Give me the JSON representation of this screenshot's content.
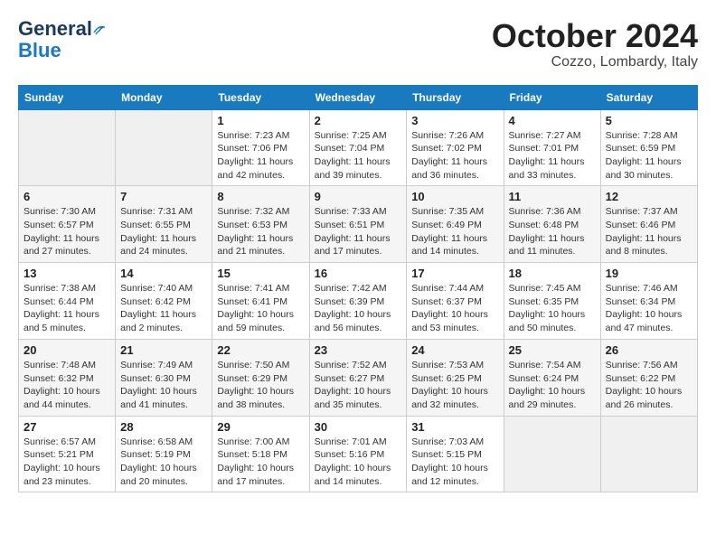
{
  "header": {
    "logo_line1": "General",
    "logo_line2": "Blue",
    "month": "October 2024",
    "location": "Cozzo, Lombardy, Italy"
  },
  "weekdays": [
    "Sunday",
    "Monday",
    "Tuesday",
    "Wednesday",
    "Thursday",
    "Friday",
    "Saturday"
  ],
  "weeks": [
    [
      {
        "day": "",
        "sunrise": "",
        "sunset": "",
        "daylight": ""
      },
      {
        "day": "",
        "sunrise": "",
        "sunset": "",
        "daylight": ""
      },
      {
        "day": "1",
        "sunrise": "Sunrise: 7:23 AM",
        "sunset": "Sunset: 7:06 PM",
        "daylight": "Daylight: 11 hours and 42 minutes."
      },
      {
        "day": "2",
        "sunrise": "Sunrise: 7:25 AM",
        "sunset": "Sunset: 7:04 PM",
        "daylight": "Daylight: 11 hours and 39 minutes."
      },
      {
        "day": "3",
        "sunrise": "Sunrise: 7:26 AM",
        "sunset": "Sunset: 7:02 PM",
        "daylight": "Daylight: 11 hours and 36 minutes."
      },
      {
        "day": "4",
        "sunrise": "Sunrise: 7:27 AM",
        "sunset": "Sunset: 7:01 PM",
        "daylight": "Daylight: 11 hours and 33 minutes."
      },
      {
        "day": "5",
        "sunrise": "Sunrise: 7:28 AM",
        "sunset": "Sunset: 6:59 PM",
        "daylight": "Daylight: 11 hours and 30 minutes."
      }
    ],
    [
      {
        "day": "6",
        "sunrise": "Sunrise: 7:30 AM",
        "sunset": "Sunset: 6:57 PM",
        "daylight": "Daylight: 11 hours and 27 minutes."
      },
      {
        "day": "7",
        "sunrise": "Sunrise: 7:31 AM",
        "sunset": "Sunset: 6:55 PM",
        "daylight": "Daylight: 11 hours and 24 minutes."
      },
      {
        "day": "8",
        "sunrise": "Sunrise: 7:32 AM",
        "sunset": "Sunset: 6:53 PM",
        "daylight": "Daylight: 11 hours and 21 minutes."
      },
      {
        "day": "9",
        "sunrise": "Sunrise: 7:33 AM",
        "sunset": "Sunset: 6:51 PM",
        "daylight": "Daylight: 11 hours and 17 minutes."
      },
      {
        "day": "10",
        "sunrise": "Sunrise: 7:35 AM",
        "sunset": "Sunset: 6:49 PM",
        "daylight": "Daylight: 11 hours and 14 minutes."
      },
      {
        "day": "11",
        "sunrise": "Sunrise: 7:36 AM",
        "sunset": "Sunset: 6:48 PM",
        "daylight": "Daylight: 11 hours and 11 minutes."
      },
      {
        "day": "12",
        "sunrise": "Sunrise: 7:37 AM",
        "sunset": "Sunset: 6:46 PM",
        "daylight": "Daylight: 11 hours and 8 minutes."
      }
    ],
    [
      {
        "day": "13",
        "sunrise": "Sunrise: 7:38 AM",
        "sunset": "Sunset: 6:44 PM",
        "daylight": "Daylight: 11 hours and 5 minutes."
      },
      {
        "day": "14",
        "sunrise": "Sunrise: 7:40 AM",
        "sunset": "Sunset: 6:42 PM",
        "daylight": "Daylight: 11 hours and 2 minutes."
      },
      {
        "day": "15",
        "sunrise": "Sunrise: 7:41 AM",
        "sunset": "Sunset: 6:41 PM",
        "daylight": "Daylight: 10 hours and 59 minutes."
      },
      {
        "day": "16",
        "sunrise": "Sunrise: 7:42 AM",
        "sunset": "Sunset: 6:39 PM",
        "daylight": "Daylight: 10 hours and 56 minutes."
      },
      {
        "day": "17",
        "sunrise": "Sunrise: 7:44 AM",
        "sunset": "Sunset: 6:37 PM",
        "daylight": "Daylight: 10 hours and 53 minutes."
      },
      {
        "day": "18",
        "sunrise": "Sunrise: 7:45 AM",
        "sunset": "Sunset: 6:35 PM",
        "daylight": "Daylight: 10 hours and 50 minutes."
      },
      {
        "day": "19",
        "sunrise": "Sunrise: 7:46 AM",
        "sunset": "Sunset: 6:34 PM",
        "daylight": "Daylight: 10 hours and 47 minutes."
      }
    ],
    [
      {
        "day": "20",
        "sunrise": "Sunrise: 7:48 AM",
        "sunset": "Sunset: 6:32 PM",
        "daylight": "Daylight: 10 hours and 44 minutes."
      },
      {
        "day": "21",
        "sunrise": "Sunrise: 7:49 AM",
        "sunset": "Sunset: 6:30 PM",
        "daylight": "Daylight: 10 hours and 41 minutes."
      },
      {
        "day": "22",
        "sunrise": "Sunrise: 7:50 AM",
        "sunset": "Sunset: 6:29 PM",
        "daylight": "Daylight: 10 hours and 38 minutes."
      },
      {
        "day": "23",
        "sunrise": "Sunrise: 7:52 AM",
        "sunset": "Sunset: 6:27 PM",
        "daylight": "Daylight: 10 hours and 35 minutes."
      },
      {
        "day": "24",
        "sunrise": "Sunrise: 7:53 AM",
        "sunset": "Sunset: 6:25 PM",
        "daylight": "Daylight: 10 hours and 32 minutes."
      },
      {
        "day": "25",
        "sunrise": "Sunrise: 7:54 AM",
        "sunset": "Sunset: 6:24 PM",
        "daylight": "Daylight: 10 hours and 29 minutes."
      },
      {
        "day": "26",
        "sunrise": "Sunrise: 7:56 AM",
        "sunset": "Sunset: 6:22 PM",
        "daylight": "Daylight: 10 hours and 26 minutes."
      }
    ],
    [
      {
        "day": "27",
        "sunrise": "Sunrise: 6:57 AM",
        "sunset": "Sunset: 5:21 PM",
        "daylight": "Daylight: 10 hours and 23 minutes."
      },
      {
        "day": "28",
        "sunrise": "Sunrise: 6:58 AM",
        "sunset": "Sunset: 5:19 PM",
        "daylight": "Daylight: 10 hours and 20 minutes."
      },
      {
        "day": "29",
        "sunrise": "Sunrise: 7:00 AM",
        "sunset": "Sunset: 5:18 PM",
        "daylight": "Daylight: 10 hours and 17 minutes."
      },
      {
        "day": "30",
        "sunrise": "Sunrise: 7:01 AM",
        "sunset": "Sunset: 5:16 PM",
        "daylight": "Daylight: 10 hours and 14 minutes."
      },
      {
        "day": "31",
        "sunrise": "Sunrise: 7:03 AM",
        "sunset": "Sunset: 5:15 PM",
        "daylight": "Daylight: 10 hours and 12 minutes."
      },
      {
        "day": "",
        "sunrise": "",
        "sunset": "",
        "daylight": ""
      },
      {
        "day": "",
        "sunrise": "",
        "sunset": "",
        "daylight": ""
      }
    ]
  ]
}
